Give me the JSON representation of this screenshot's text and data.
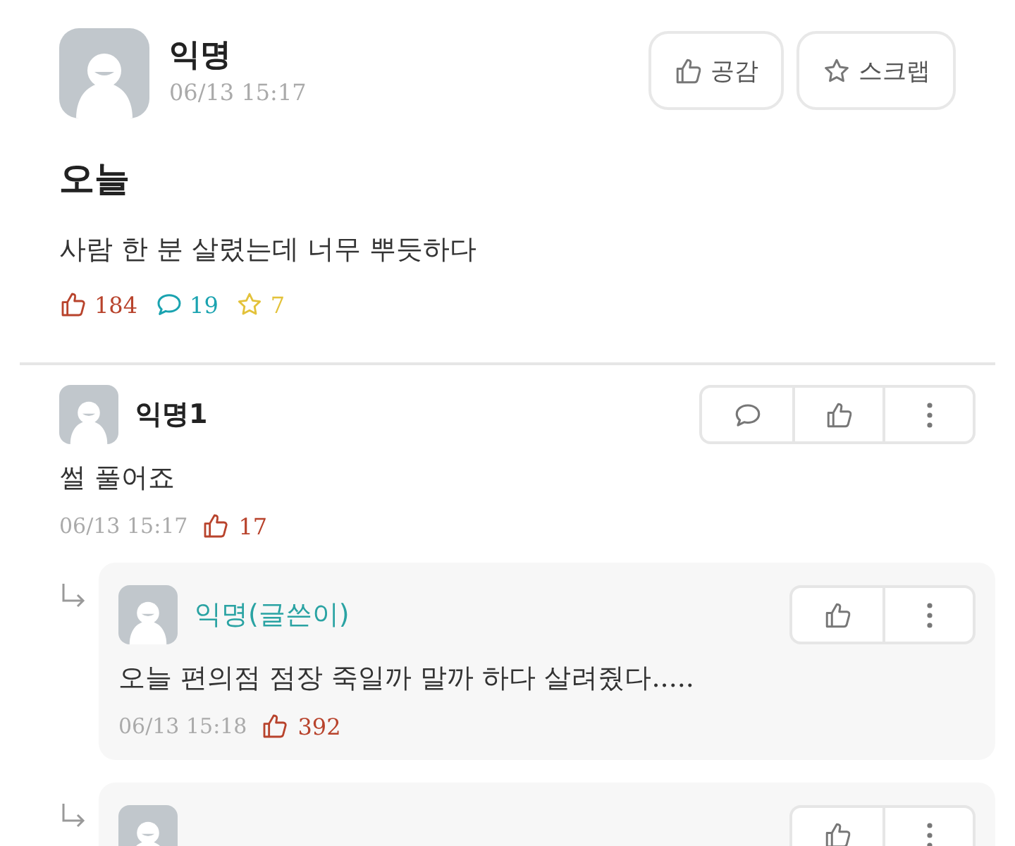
{
  "post": {
    "author": "익명",
    "time": "06/13 15:17",
    "buttons": [
      {
        "kind": "like",
        "label": "공감"
      },
      {
        "kind": "scrap",
        "label": "스크랩"
      }
    ],
    "title": "오늘",
    "body": "사람 한 분 살렸는데 너무 뿌듯하다",
    "stats": [
      {
        "kind": "like",
        "value": "184",
        "color": "#b8432c"
      },
      {
        "kind": "comment",
        "value": "19",
        "color": "#1aa3b0"
      },
      {
        "kind": "scrap",
        "value": "7",
        "color": "#e3c23a"
      }
    ]
  },
  "comments": [
    {
      "kind": "comment",
      "author": "익명1",
      "is_writer": false,
      "text": "썰 풀어죠",
      "time": "06/13 15:17",
      "likes": "17"
    },
    {
      "kind": "reply",
      "author": "익명(글쓴이)",
      "is_writer": true,
      "text": "오늘 편의점 점장 죽일까 말까 하다 살려줬다.....",
      "time": "06/13 15:18",
      "likes": "392"
    },
    {
      "kind": "reply"
    }
  ]
}
